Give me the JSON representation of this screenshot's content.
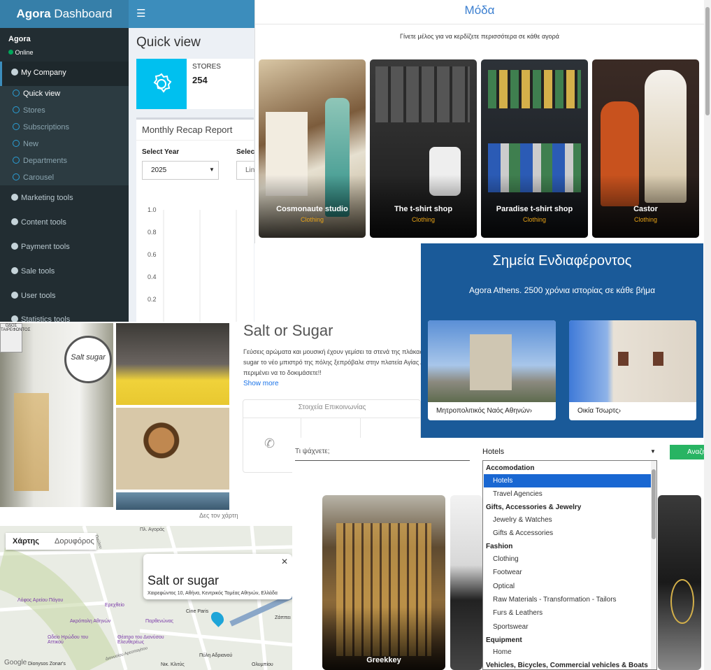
{
  "dashboard": {
    "brand_bold": "Agora",
    "brand_rest": "Dashboard",
    "user_name": "Agora",
    "user_status": "Online",
    "menu_header": "My Company",
    "submenu": [
      "Quick view",
      "Stores",
      "Subscriptions",
      "New",
      "Departments",
      "Carousel"
    ],
    "menu": [
      "Marketing tools",
      "Content tools",
      "Payment tools",
      "Sale tools",
      "User tools",
      "Statistics tools"
    ],
    "page_title": "Quick view",
    "stores_label": "STORES",
    "stores_count": "254",
    "recap_title": "Monthly Recap Report",
    "select_year_label": "Select Year",
    "select_year_value": "2025",
    "select_partial_label": "Selec",
    "select_partial_value": "Lin",
    "chart_data": {
      "type": "line",
      "yticks": [
        "1.0",
        "0.8",
        "0.6",
        "0.4",
        "0.2"
      ],
      "ylim": [
        0,
        1
      ],
      "series": []
    }
  },
  "moda": {
    "title": "Μόδα",
    "subtitle": "Γίνετε μέλος για να κερδίζετε περισσότερα σε κάθε αγορά",
    "cards": [
      {
        "name": "Cosmonaute studio",
        "category": "Clothing"
      },
      {
        "name": "The t-shirt shop",
        "category": "Clothing"
      },
      {
        "name": "Paradise t-shirt shop",
        "category": "Clothing"
      },
      {
        "name": "Castor",
        "category": "Clothing"
      }
    ]
  },
  "poi": {
    "title": "Σημεία Ενδιαφέροντος",
    "subtitle": "Agora Athens. 2500 χρόνια ιστορίας σε κάθε βήμα",
    "cards": [
      {
        "label": "Μητροπολιτικός Ναός Αθηνών›"
      },
      {
        "label": "Οικία Τσωρτς›"
      }
    ]
  },
  "salt": {
    "title": "Salt or Sugar",
    "desc_line1": "Γεύσεις αρώματα και μουσική έχουν γεμίσει τα στενά της πλάκας κα",
    "desc_line2": "sugar το νέο μπιστρό της πόλης ξεπρόβαλε στην πλατεία Αγίας Αι",
    "desc_line3": "περιμένει να το δοκιμάσετε!!",
    "show_more": "Show more",
    "contact_title": "Στοιχεία Επικοινωνίας",
    "see_map": "Δες τον χάρτη",
    "sign_text": "Salt sugar",
    "street_sign": "ΟΔΟΣ ΤΑΙΡΕΦΩΝΤΟΣ"
  },
  "map": {
    "tab_map": "Χάρτης",
    "tab_satellite": "Δορυφόρος",
    "place_name": "Salt or sugar",
    "place_address": "Χαιρεφώντος 10, Αθήνα, Κεντρικός Τομέας Αθηνών, Ελλάδα",
    "labels": [
      "Πλ. Αγοράς",
      "Λόφος Αρείου Πάγου",
      "Ερεχθείο",
      "Ακρόπολη Αθηνών",
      "Παρθενώνας",
      "Ωδείο Ηρώδου του Αττικού",
      "Θέατρο του Διονύσου Ελευθερέως",
      "Cine Paris",
      "Ζάππει",
      "Πύλη Αδριανού",
      "Διονυσίου Αρεοπαγίτου",
      "Παύλου",
      "Dionysos Zonar's",
      "Νικ. Κλιτύς",
      "Ολυμπίου",
      "Google"
    ]
  },
  "search": {
    "placeholder": "Τι ψάχνετε;",
    "select_value": "Hotels",
    "button_label": "Αναζή",
    "dropdown_groups": [
      {
        "label": "Accomodation",
        "options": [
          "Hotels",
          "Travel Agencies"
        ]
      },
      {
        "label": "Gifts, Accessories & Jewelry",
        "options": [
          "Jewelry & Watches",
          "Gifts & Accessories"
        ]
      },
      {
        "label": "Fashion",
        "options": [
          "Clothing",
          "Footwear",
          "Optical",
          "Raw Materials - Transformation - Tailors",
          "Furs & Leathers",
          "Sportswear"
        ]
      },
      {
        "label": "Equipment",
        "options": [
          "Home"
        ]
      },
      {
        "label": "Vehicles, Bicycles, Commercial vehicles & Boats",
        "options": []
      }
    ],
    "shop_card_label": "Greekkey"
  },
  "colors": {
    "sidebar": "#222d32",
    "brand": "#367fa9",
    "topbar": "#3c8dbc",
    "info_box": "#00c0ef",
    "poi_bg": "#1a5a99",
    "select_highlight": "#1967d2",
    "search_button": "#28b463",
    "accent_category": "#e8a317"
  }
}
